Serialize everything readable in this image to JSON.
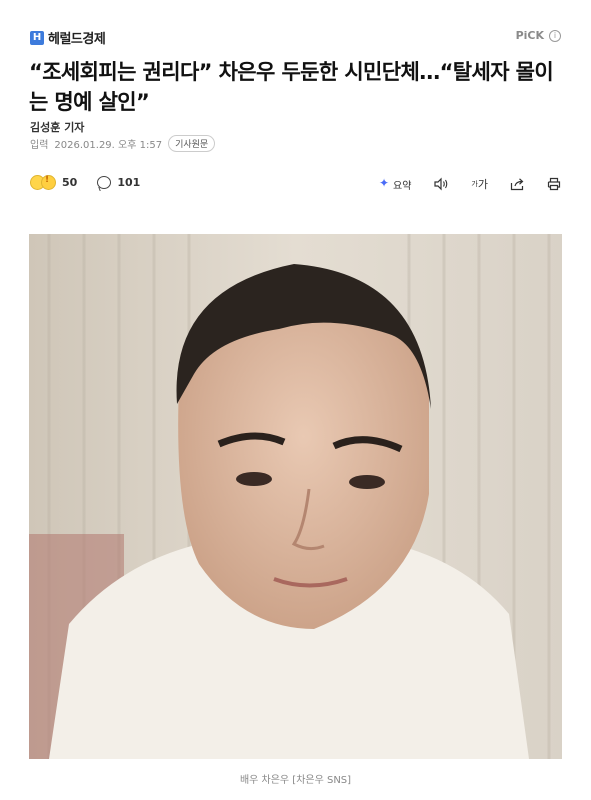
{
  "header": {
    "brand_logo": "H",
    "brand_name": "헤럴드경제",
    "pick_label": "PiCK",
    "info_icon": "i"
  },
  "article": {
    "headline": "“조세회피는 권리다” 차은우 두둔한 시민단체…“탈세자 몰이는 명예 살인”",
    "byline": "김성훈 기자",
    "published_label": "입력",
    "published_datetime": "2026.01.29. 오후 1:57",
    "original_button": "기사원문"
  },
  "toolbar": {
    "reaction_count": "50",
    "comment_count": "101",
    "summary_label": "요약",
    "font_label": "가",
    "font_small": "가"
  },
  "photo": {
    "caption": "배우 차은우 [차은우 SNS]"
  },
  "colors": {
    "accent": "#3d7bdc",
    "summary_icon": "#4a6cf7"
  }
}
